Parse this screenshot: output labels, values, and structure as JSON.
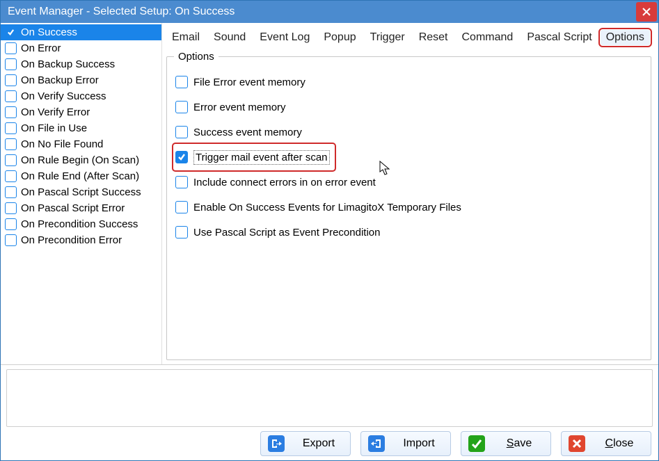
{
  "window": {
    "title": "Event Manager - Selected Setup: On Success"
  },
  "sidebar": {
    "items": [
      {
        "label": "On Success",
        "checked": true,
        "selected": true
      },
      {
        "label": "On Error",
        "checked": false,
        "selected": false
      },
      {
        "label": "On Backup Success",
        "checked": false,
        "selected": false
      },
      {
        "label": "On Backup Error",
        "checked": false,
        "selected": false
      },
      {
        "label": "On Verify Success",
        "checked": false,
        "selected": false
      },
      {
        "label": "On Verify Error",
        "checked": false,
        "selected": false
      },
      {
        "label": "On File in Use",
        "checked": false,
        "selected": false
      },
      {
        "label": "On No File Found",
        "checked": false,
        "selected": false
      },
      {
        "label": "On Rule Begin (On Scan)",
        "checked": false,
        "selected": false
      },
      {
        "label": "On Rule End (After Scan)",
        "checked": false,
        "selected": false
      },
      {
        "label": "On Pascal Script Success",
        "checked": false,
        "selected": false
      },
      {
        "label": "On Pascal Script Error",
        "checked": false,
        "selected": false
      },
      {
        "label": "On Precondition Success",
        "checked": false,
        "selected": false
      },
      {
        "label": "On Precondition Error",
        "checked": false,
        "selected": false
      }
    ]
  },
  "tabs": {
    "items": [
      {
        "label": "Email",
        "active": false
      },
      {
        "label": "Sound",
        "active": false
      },
      {
        "label": "Event Log",
        "active": false
      },
      {
        "label": "Popup",
        "active": false
      },
      {
        "label": "Trigger",
        "active": false
      },
      {
        "label": "Reset",
        "active": false
      },
      {
        "label": "Command",
        "active": false
      },
      {
        "label": "Pascal Script",
        "active": false
      },
      {
        "label": "Options",
        "active": true
      }
    ]
  },
  "options_group": {
    "legend": "Options",
    "items": [
      {
        "label": "File Error event memory",
        "checked": false,
        "highlight": false
      },
      {
        "label": "Error event memory",
        "checked": false,
        "highlight": false
      },
      {
        "label": "Success event memory",
        "checked": false,
        "highlight": false
      },
      {
        "label": "Trigger mail event after scan",
        "checked": true,
        "highlight": true
      },
      {
        "label": "Include connect errors in on error event",
        "checked": false,
        "highlight": false
      },
      {
        "label": "Enable On Success Events for LimagitoX Temporary Files",
        "checked": false,
        "highlight": false
      },
      {
        "label": "Use Pascal Script as Event Precondition",
        "checked": false,
        "highlight": false
      }
    ]
  },
  "buttons": {
    "export": "Export",
    "import": "Import",
    "save": "Save",
    "close": "Close"
  },
  "colors": {
    "accent": "#1a84e9",
    "highlight_border": "#cf2a2a",
    "titlebar": "#4b8bcf"
  }
}
